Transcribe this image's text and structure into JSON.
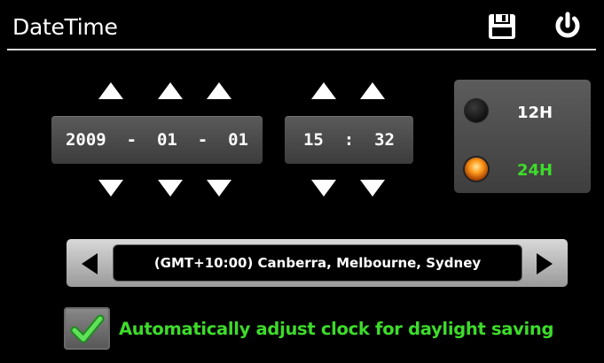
{
  "header": {
    "title": "DateTime",
    "icons": {
      "save": "floppy-disk-icon",
      "power": "power-icon"
    }
  },
  "date": {
    "year": "2009",
    "month": "01",
    "day": "01",
    "separator": "-"
  },
  "time": {
    "hour": "15",
    "minute": "32",
    "separator": ":"
  },
  "format": {
    "options": [
      {
        "label": "12H",
        "selected": false
      },
      {
        "label": "24H",
        "selected": true
      }
    ]
  },
  "timezone": {
    "value": "(GMT+10:00) Canberra, Melbourne, Sydney"
  },
  "dst": {
    "checked": true,
    "label": "Automatically adjust clock for daylight saving"
  },
  "colors": {
    "accent_green": "#3ddc2a",
    "background": "#000000",
    "selected_radio": "#ff9a1a"
  }
}
